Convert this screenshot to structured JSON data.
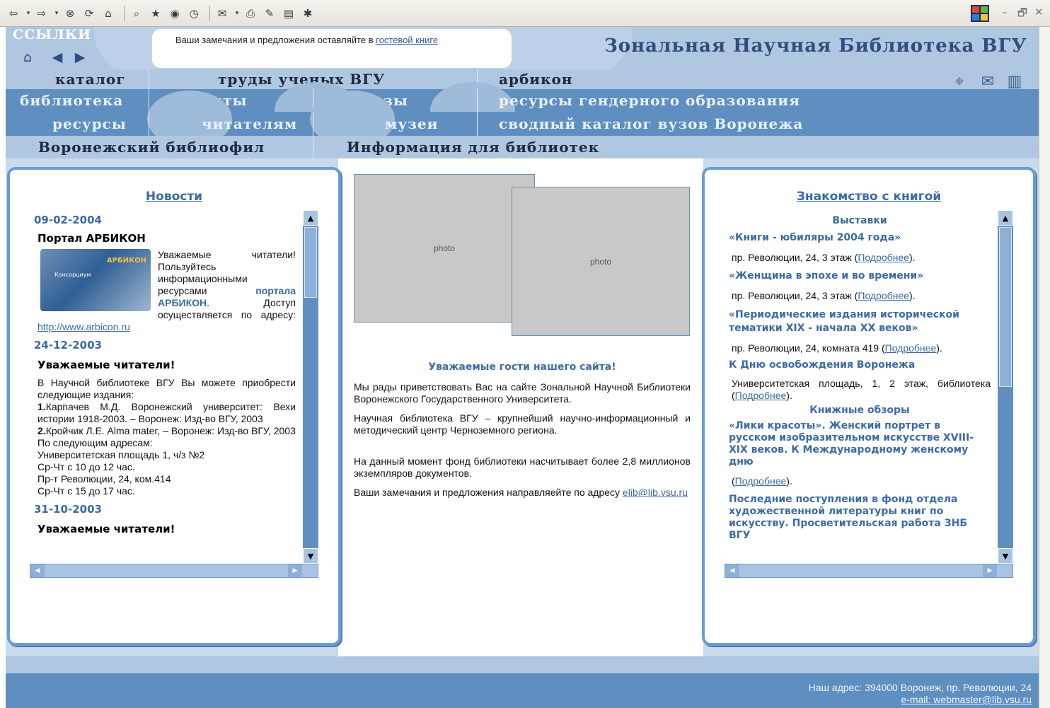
{
  "browser": {
    "toolbar_icons": [
      "back-icon",
      "forward-icon",
      "stop-icon",
      "refresh-icon",
      "home-icon",
      "search-icon",
      "favorites-icon",
      "media-icon",
      "history-icon",
      "mail-icon",
      "print-icon",
      "edit-icon",
      "discuss-icon",
      "messenger-icon"
    ],
    "window_controls": [
      "–",
      "🗗",
      "✕"
    ]
  },
  "header": {
    "links_label": "ССЫЛКИ",
    "links_icons": [
      "home-icon",
      "back-icon",
      "forward-icon"
    ],
    "notice_text": "Ваши замечания и предложения оставляйте в ",
    "notice_link": "гостевой книге",
    "site_title": "Зональная Научная Библиотека ВГУ",
    "tool_icons": [
      "sitemap-icon",
      "mail-icon",
      "book-icon"
    ]
  },
  "nav": {
    "row1": [
      "каталог",
      "труды ученых ВГУ",
      "арбикон"
    ],
    "row2": [
      "библиотека",
      "проекты",
      "заказы",
      "ресурсы гендерного образования"
    ],
    "row3": [
      "ресурсы",
      "читателям",
      "музеи",
      "сводный каталог вузов Воронежа"
    ],
    "row4": [
      "Воронежский библиофил",
      "Информация для библиотек"
    ]
  },
  "news": {
    "title": "Новости",
    "items": [
      {
        "date": "09-02-2004",
        "headline": "Портал АРБИКОН",
        "image_label": "АРБИКОН",
        "image_sublabel": "Консорциум",
        "text_1": "Уважаемые читатели! Пользуйтесь информационными ресурсами ",
        "text_link": "портала АРБИКОН",
        "text_2": ". Доступ осуществляется по адресу: ",
        "url": "http://www.arbicon.ru"
      },
      {
        "date": "24-12-2003",
        "headline": "Уважаемые читатели!",
        "intro": "В Научной библиотеке ВГУ Вы можете приобрести следующие издания:",
        "book1_num": "1.",
        "book1": "Карпачев М.Д. Воронежский университет: Вехи истории 1918-2003. – Воронеж: Изд-во ВГУ, 2003",
        "book2_num": "2.",
        "book2": "Кройчик Л.Е. Alma mater, – Воронеж: Изд-во ВГУ, 2003",
        "addr_intro": "По следующим адресам:",
        "addr1": "Университетская площадь 1, ч/з №2",
        "hours1": "Ср-Чт с 10 до 12 час.",
        "addr2": "Пр-т Революции, 24, ком.414",
        "hours2": "Ср-Чт с 15 до 17 час."
      },
      {
        "date": "31-10-2003",
        "headline": "Уважаемые читатели!"
      }
    ]
  },
  "welcome": {
    "heading": "Уважаемые гости нашего сайта!",
    "p1": "Мы рады приветствовать Вас на сайте Зональной Научной Библиотеки Воронежского Государственного Университета.",
    "p2": "Научная библиотека ВГУ – крупнейший научно-информационный и методический центр Черноземного региона.",
    "p3": "На данный момент фонд библиотеки насчитывает более 2,8 миллионов экземпляров документов.",
    "p4": "Ваши замечания и предложения направляейте по адресу ",
    "email": "elib@lib.vsu.ru"
  },
  "books": {
    "title": "Знакомство с книгой",
    "section_exhibitions": "Выставки",
    "ex1_title": "«Книги - юбиляры 2004 года»",
    "ex1_place": "пр. Революции, 24, 3 этаж (",
    "ex2_title": "«Женщина в эпохе и во времени»",
    "ex2_place": "пр. Революции, 24, 3 этаж (",
    "ex3_title": "«Периодические издания исторической тематики XIX - начала XX веков»",
    "ex3_place": "пр. Революции, 24, комната 419 (",
    "ex4_title": "К Дню освобождения Воронежа",
    "ex4_place": "Университетская площадь, 1, 2 этаж, библиотека (",
    "section_reviews": "Книжные обзоры",
    "rev1_title": "«Лики красоты». Женский портрет в русском изобразительном искусстве XVIII-XIX веков. К Международному женскому дню",
    "rev1_place": "(",
    "rev2_title": "Последние поступления в фонд отдела художественной литературы книг по искусству. Просветительская работа ЗНБ ВГУ",
    "more": "Подробнее",
    "close": ")."
  },
  "footer": {
    "address": "Наш адрес: 394000 Воронеж, пр. Революции, 24",
    "email": "e-mail: webmaster@lib.vsu.ru"
  },
  "colors": {
    "nav_dark": "#5f8fc0",
    "nav_light": "#afc7e1",
    "accent_text": "#3c6aa5",
    "panel_border": "#6d9cd0"
  }
}
